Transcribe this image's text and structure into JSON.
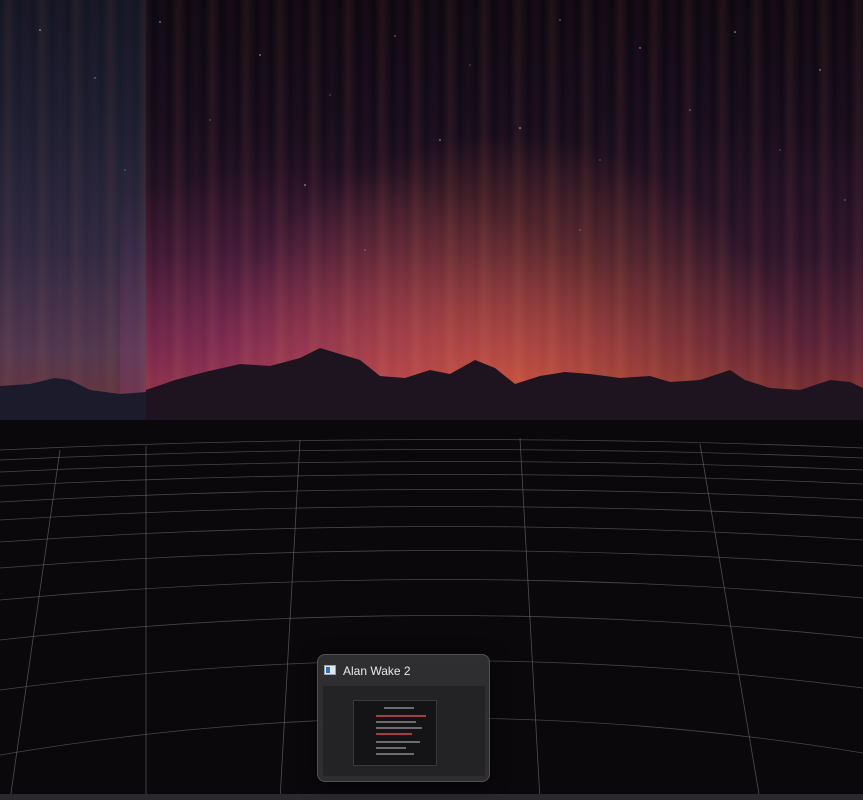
{
  "wallpaper": {
    "description_icon": "synthwave-aurora-wallpaper"
  },
  "taskbar_thumbnail": {
    "title": "Alan Wake 2",
    "app_icon": "application-window-icon"
  }
}
